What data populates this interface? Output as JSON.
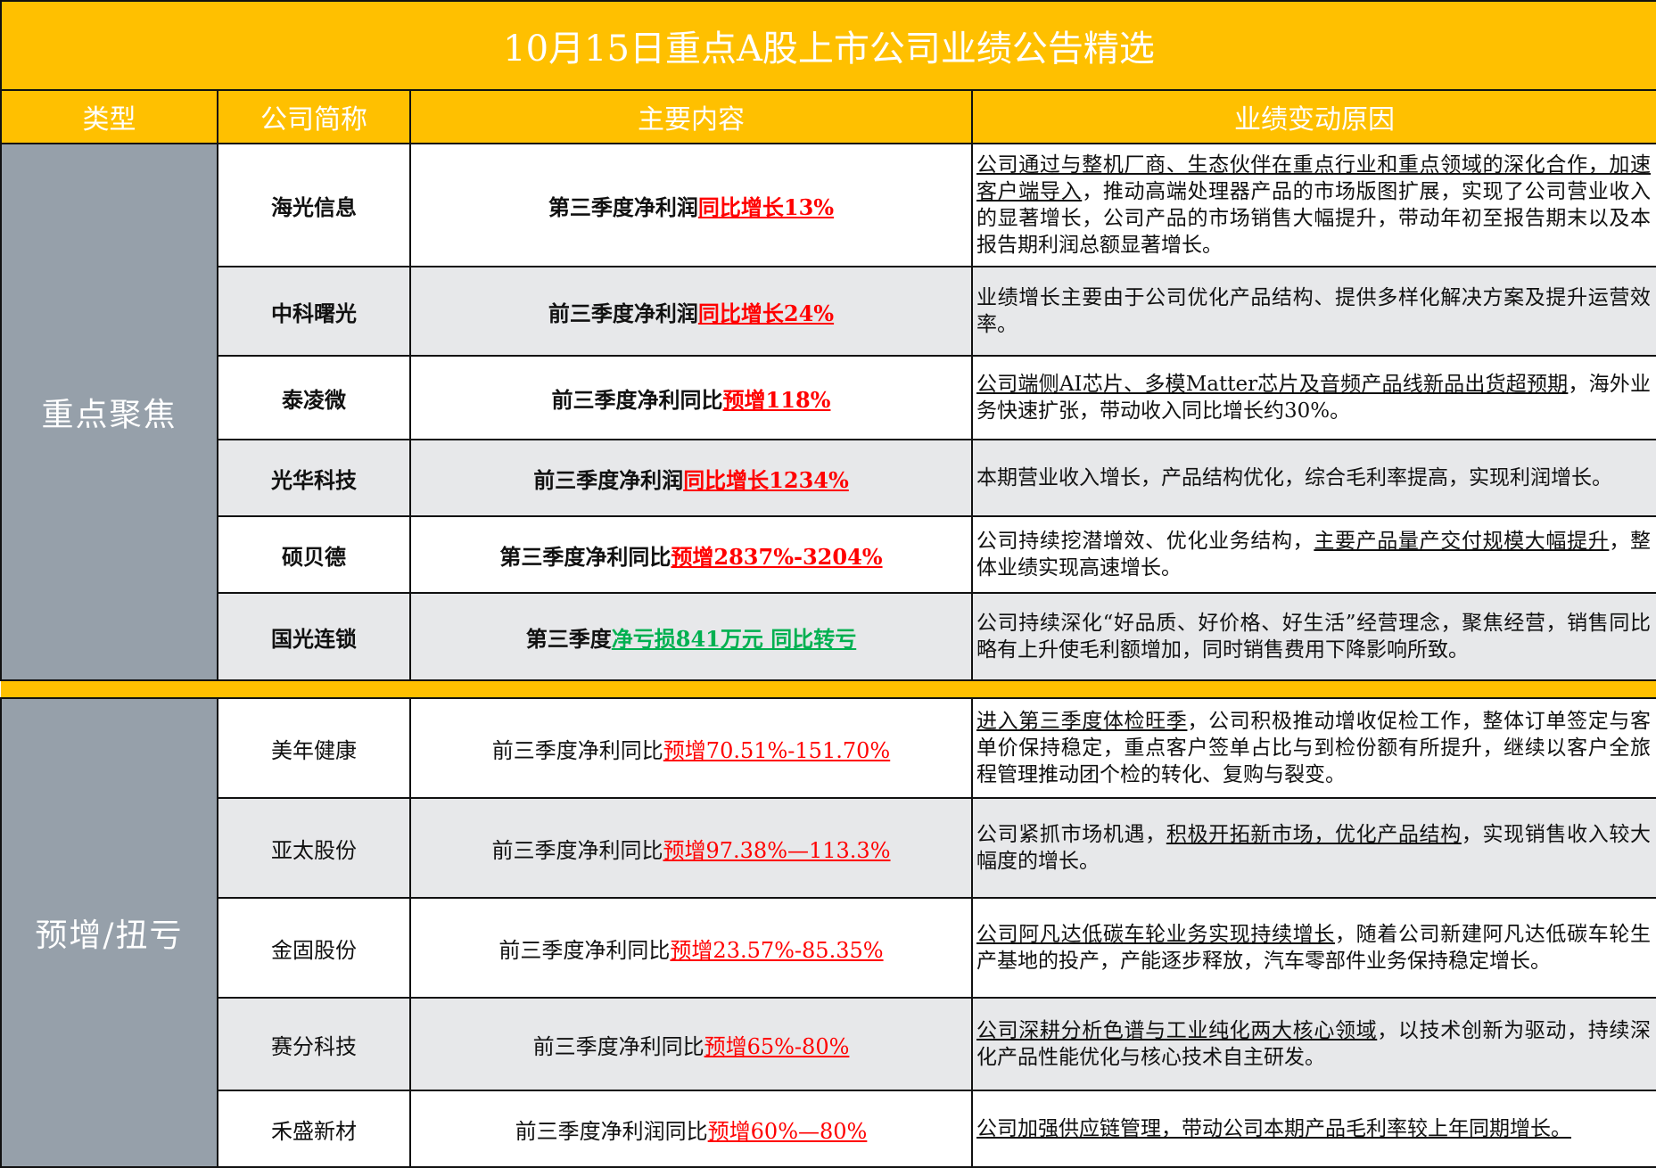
{
  "title": "10月15日重点A股上市公司业绩公告精选",
  "headers": [
    "类型",
    "公司简称",
    "主要内容",
    "业绩变动原因"
  ],
  "colors": {
    "accent": "#ffc000",
    "category": "#96a0aa",
    "alt_row": "#e7e8ea",
    "up": "#ff0000",
    "down": "#00b050"
  },
  "groups": [
    {
      "label": "重点聚焦",
      "rows": [
        {
          "name": "海光信息",
          "main": "第三季度净利润",
          "hl": "同比增长13%",
          "reason": [
            {
              "t": "公司通过与整机厂商、生态伙伴在重点行业和重点领域的深化合作，加速客户端导入",
              "u": true
            },
            {
              "t": "，推动高端处理器产品的市场版图扩展，实现了公司营业收入的显著增长，公司产品的市场销售大幅提升，带动年初至报告期末以及本报告期利润总额显著增长。",
              "u": false
            }
          ]
        },
        {
          "name": "中科曙光",
          "main": "前三季度净利润",
          "hl": "同比增长24%",
          "reason": [
            {
              "t": "业绩增长主要由于公司优化产品结构、提供多样化解决方案及提升运营效率。",
              "u": false
            }
          ]
        },
        {
          "name": "泰凌微",
          "main": "前三季度净利同比",
          "hl": "预增118%",
          "reason": [
            {
              "t": "公司端侧AI芯片、多模Matter芯片及音频产品线新品出货超预期",
              "u": true
            },
            {
              "t": "，海外业务快速扩张，带动收入同比增长约30%。",
              "u": false
            }
          ]
        },
        {
          "name": "光华科技",
          "main": "前三季度净利润",
          "hl": "同比增长1234%",
          "reason": [
            {
              "t": "本期营业收入增长，产品结构优化，综合毛利率提高，实现利润增长。",
              "u": false
            }
          ]
        },
        {
          "name": "硕贝德",
          "main": "第三季度净利同比",
          "hl": "预增2837%-3204%",
          "reason": [
            {
              "t": "公司持续挖潜增效、优化业务结构，",
              "u": false
            },
            {
              "t": "主要产品量产交付规模大幅提升",
              "u": true
            },
            {
              "t": "，整体业绩实现高速增长。",
              "u": false
            }
          ]
        },
        {
          "name": "国光连锁",
          "main": "第三季度",
          "hl": "净亏损841万元 同比转亏",
          "down": true,
          "reason": [
            {
              "t": "公司持续深化“好品质、好价格、好生活”经营理念，聚焦经营，销售同比略有上升使毛利额增加，同时销售费用下降影响所致。",
              "u": false
            }
          ]
        }
      ]
    },
    {
      "label": "预增/扭亏",
      "rows": [
        {
          "name": "美年健康",
          "main": "前三季度净利同比",
          "hl": "预增70.51%-151.70%",
          "reason": [
            {
              "t": "进入第三季度体检旺季",
              "u": true
            },
            {
              "t": "，公司积极推动增收促检工作，整体订单签定与客单价保持稳定，重点客户签单占比与到检份额有所提升，继续以客户全旅程管理推动团个检的转化、复购与裂变。",
              "u": false
            }
          ]
        },
        {
          "name": "亚太股份",
          "main": "前三季度净利同比",
          "hl": "预增97.38%—113.3%",
          "reason": [
            {
              "t": "公司紧抓市场机遇，",
              "u": false
            },
            {
              "t": "积极开拓新市场，优化产品结构",
              "u": true
            },
            {
              "t": "，实现销售收入较大幅度的增长。",
              "u": false
            }
          ]
        },
        {
          "name": "金固股份",
          "main": "前三季度净利同比",
          "hl": "预增23.57%-85.35%",
          "reason": [
            {
              "t": "公司阿凡达低碳车轮业务实现持续增长",
              "u": true
            },
            {
              "t": "，随着公司新建阿凡达低碳车轮生产基地的投产，产能逐步释放，汽车零部件业务保持稳定增长。",
              "u": false
            }
          ]
        },
        {
          "name": "赛分科技",
          "main": "前三季度净利同比",
          "hl": "预增65%-80%",
          "reason": [
            {
              "t": "公司深耕分析色谱与工业纯化两大核心领域",
              "u": true
            },
            {
              "t": "，以技术创新为驱动，持续深化产品性能优化与核心技术自主研发。",
              "u": false
            }
          ]
        },
        {
          "name": "禾盛新材",
          "main": "前三季度净利润同比",
          "hl": "预增60%—80%",
          "reason": [
            {
              "t": "公司加强供应链管理，带动公司本期产品毛利率较上年同期增长。",
              "u": true
            }
          ]
        }
      ]
    }
  ]
}
